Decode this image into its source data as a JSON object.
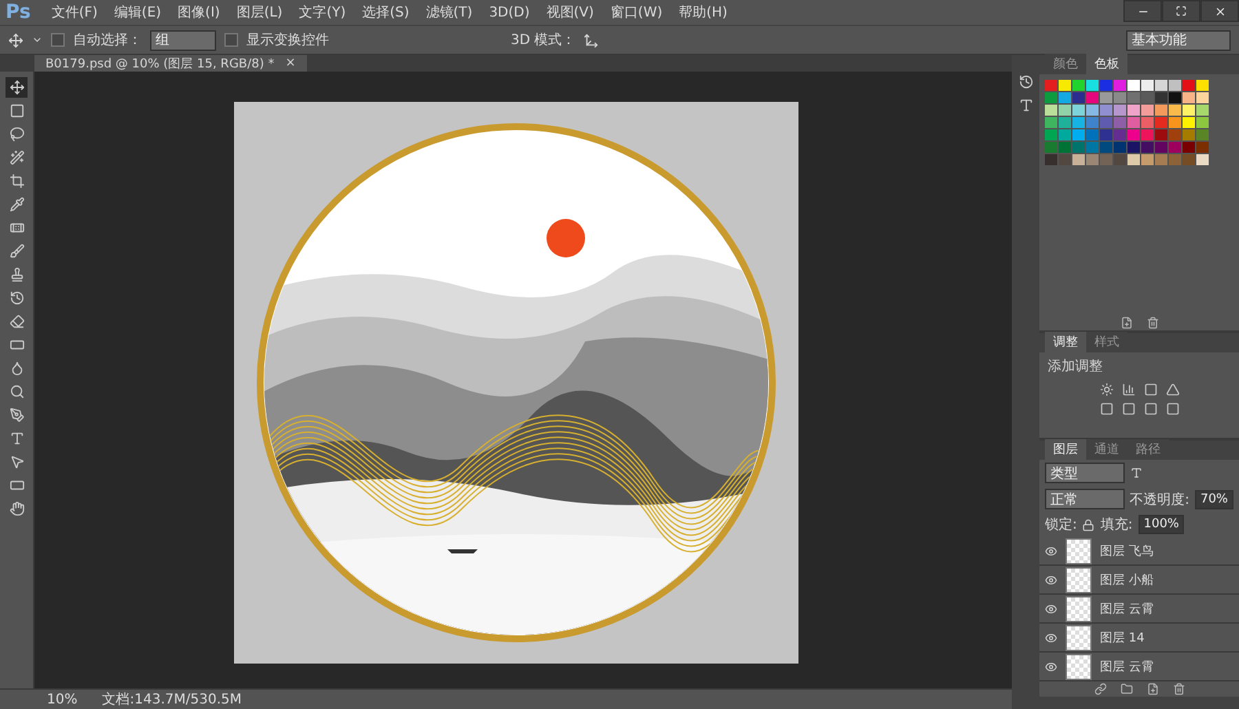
{
  "app": {
    "logo": "Ps"
  },
  "menu": [
    "文件(F)",
    "编辑(E)",
    "图像(I)",
    "图层(L)",
    "文字(Y)",
    "选择(S)",
    "滤镜(T)",
    "3D(D)",
    "视图(V)",
    "窗口(W)",
    "帮助(H)"
  ],
  "options_bar": {
    "auto_select": {
      "label": "自动选择：",
      "checked": false,
      "value": "组"
    },
    "transform_controls": {
      "label": "显示变换控件",
      "checked": false
    },
    "mode_3d_label": "3D 模式：",
    "workspace": "基本功能"
  },
  "document_tab": {
    "title": "B0179.psd @ 10% (图层 15, RGB/8) *",
    "close": "×"
  },
  "tools": [
    {
      "selected": true
    },
    {
      "selected": false
    },
    {
      "selected": false
    },
    {
      "selected": false
    },
    {
      "selected": false
    },
    {
      "selected": false
    },
    {
      "selected": false
    },
    {
      "selected": false
    },
    {
      "selected": false
    },
    {
      "selected": false
    },
    {
      "selected": false
    },
    {
      "selected": false
    },
    {
      "selected": false
    },
    {
      "selected": false
    },
    {
      "selected": false
    },
    {
      "selected": false
    },
    {
      "selected": false
    },
    {
      "selected": false
    },
    {
      "selected": false
    }
  ],
  "color_panel": {
    "tabs": [
      {
        "label": "颜色",
        "selected": false
      },
      {
        "label": "色板",
        "selected": true
      }
    ]
  },
  "adjustments_panel": {
    "tabs": [
      {
        "label": "调整",
        "selected": true
      },
      {
        "label": "样式",
        "selected": false
      }
    ],
    "heading": "添加调整"
  },
  "layers_panel": {
    "tabs": [
      {
        "label": "图层",
        "selected": true
      },
      {
        "label": "通道",
        "selected": false
      },
      {
        "label": "路径",
        "selected": false
      }
    ],
    "filter": "类型",
    "blend_mode": "正常",
    "opacity_label": "不透明度:",
    "opacity": "70%",
    "lock_label": "锁定:",
    "fill_label": "填充:",
    "fill": "100%",
    "layers": [
      {
        "name": "图层 飞鸟",
        "visible": true
      },
      {
        "name": "图层 小船",
        "visible": true
      },
      {
        "name": "图层 云霄",
        "visible": true
      },
      {
        "name": "图层 14",
        "visible": true
      },
      {
        "name": "图层 云霄",
        "visible": true
      }
    ]
  },
  "status_bar": {
    "zoom": "10%",
    "doc_size": "文档:143.7M/530.5M"
  }
}
